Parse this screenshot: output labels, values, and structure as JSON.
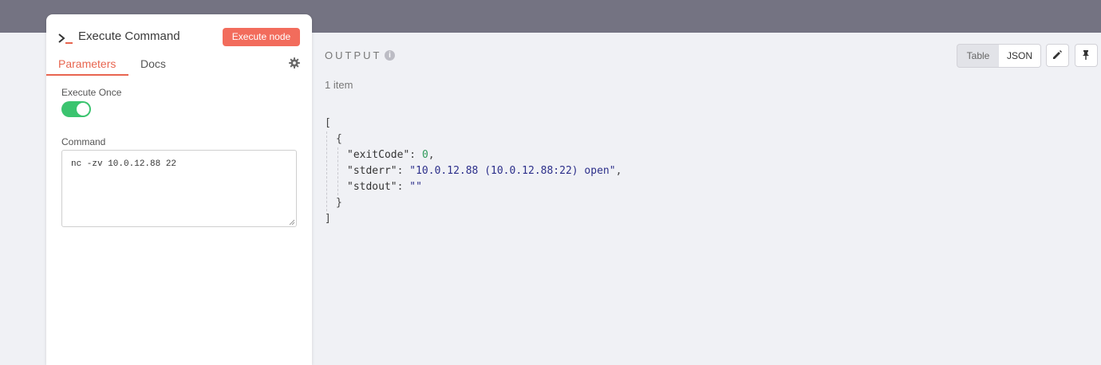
{
  "node": {
    "title": "Execute Command",
    "icon": "terminal-icon",
    "execute_button": "Execute node",
    "tabs": {
      "parameters": "Parameters",
      "docs": "Docs"
    },
    "execute_once_label": "Execute Once",
    "execute_once": true,
    "command_label": "Command",
    "command_value": "nc -zv 10.0.12.88 22"
  },
  "output": {
    "title": "OUTPUT",
    "info_icon": "info-icon",
    "view_table": "Table",
    "view_json": "JSON",
    "active_view": "JSON",
    "items_count": "1 item",
    "json": {
      "open_bracket": "[",
      "open_brace": "{",
      "exitCode_key": "\"exitCode\"",
      "exitCode_value": "0",
      "stderr_key": "\"stderr\"",
      "stderr_value": "\"10.0.12.88 (10.0.12.88:22) open\"",
      "stdout_key": "\"stdout\"",
      "stdout_value": "\"\"",
      "close_brace": "}",
      "close_bracket": "]"
    }
  },
  "colors": {
    "topbar": "#747382",
    "accent": "#f26c5c",
    "toggle_on": "#3bc46f",
    "json_string": "#2c2f8a",
    "json_number": "#2e9a5a"
  }
}
